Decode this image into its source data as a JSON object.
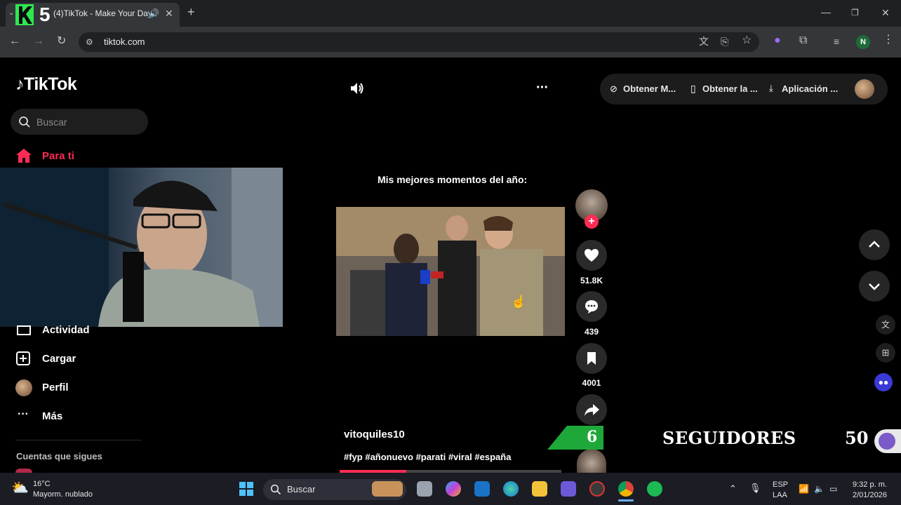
{
  "browser": {
    "tab_title": "(4)TikTok - Make Your Day",
    "url": "tiktok.com",
    "profile_initial": "N"
  },
  "overlay": {
    "logo_text": "K5"
  },
  "sidebar": {
    "brand": "TikTok",
    "search_placeholder": "Buscar",
    "items": [
      {
        "label": "Para ti"
      },
      {
        "label": "Actividad"
      },
      {
        "label": "Cargar"
      },
      {
        "label": "Perfil"
      },
      {
        "label": "Más"
      }
    ],
    "following_heading": "Cuentas que sigues"
  },
  "top_actions": {
    "items": [
      {
        "label": "Obtener M..."
      },
      {
        "label": "Obtener la ..."
      },
      {
        "label": "Aplicación ..."
      }
    ]
  },
  "video": {
    "caption_title": "Mis mejores momentos del año:",
    "username": "vitoquiles10",
    "hashtags": "#fyp #añonuevo #parati #viral #españa",
    "likes": "51.8K",
    "comments": "439",
    "saves": "4001"
  },
  "followers_banner": {
    "count_left": "6",
    "label": "SEGUIDORES",
    "goal": "50"
  },
  "taskbar": {
    "weather_temp": "16°C",
    "weather_desc": "Mayorm. nublado",
    "search_label": "Buscar",
    "lang": "ESP",
    "lang_sub": "LAA",
    "time": "9:32 p. m.",
    "date": "2/01/2026"
  },
  "colors": {
    "tiktok_red": "#fe2c55",
    "banner_green": "#1fa83a"
  }
}
